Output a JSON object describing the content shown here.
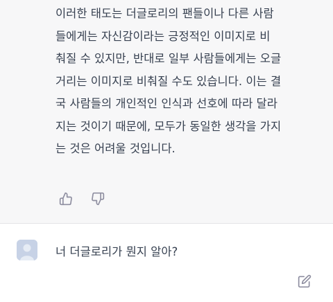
{
  "assistant": {
    "lines": [
      "이러한 태도는 더글로리의 팬들이나 다른 사람",
      "들에게는 자신감이라는 긍정적인 이미지로 비",
      "춰질 수 있지만, 반대로 일부 사람들에게는 오글",
      "거리는 이미지로 비춰질 수도 있습니다. 이는 결",
      "국 사람들의 개인적인 인식과 선호에 따라 달라",
      "지는 것이기 때문에, 모두가 동일한 생각을 가지",
      "는 것은 어려울 것입니다."
    ],
    "feedback_icons": [
      "thumbs-up-icon",
      "thumbs-down-icon"
    ]
  },
  "user": {
    "message": "너 더글로리가 뭔지 알아?",
    "edit_icon": "edit-icon"
  },
  "colors": {
    "assistant_bg": "#f7f7f8",
    "user_bg": "#ffffff",
    "text": "#374151",
    "icon": "#8e8ea0",
    "avatar": "#c7d2e6"
  }
}
